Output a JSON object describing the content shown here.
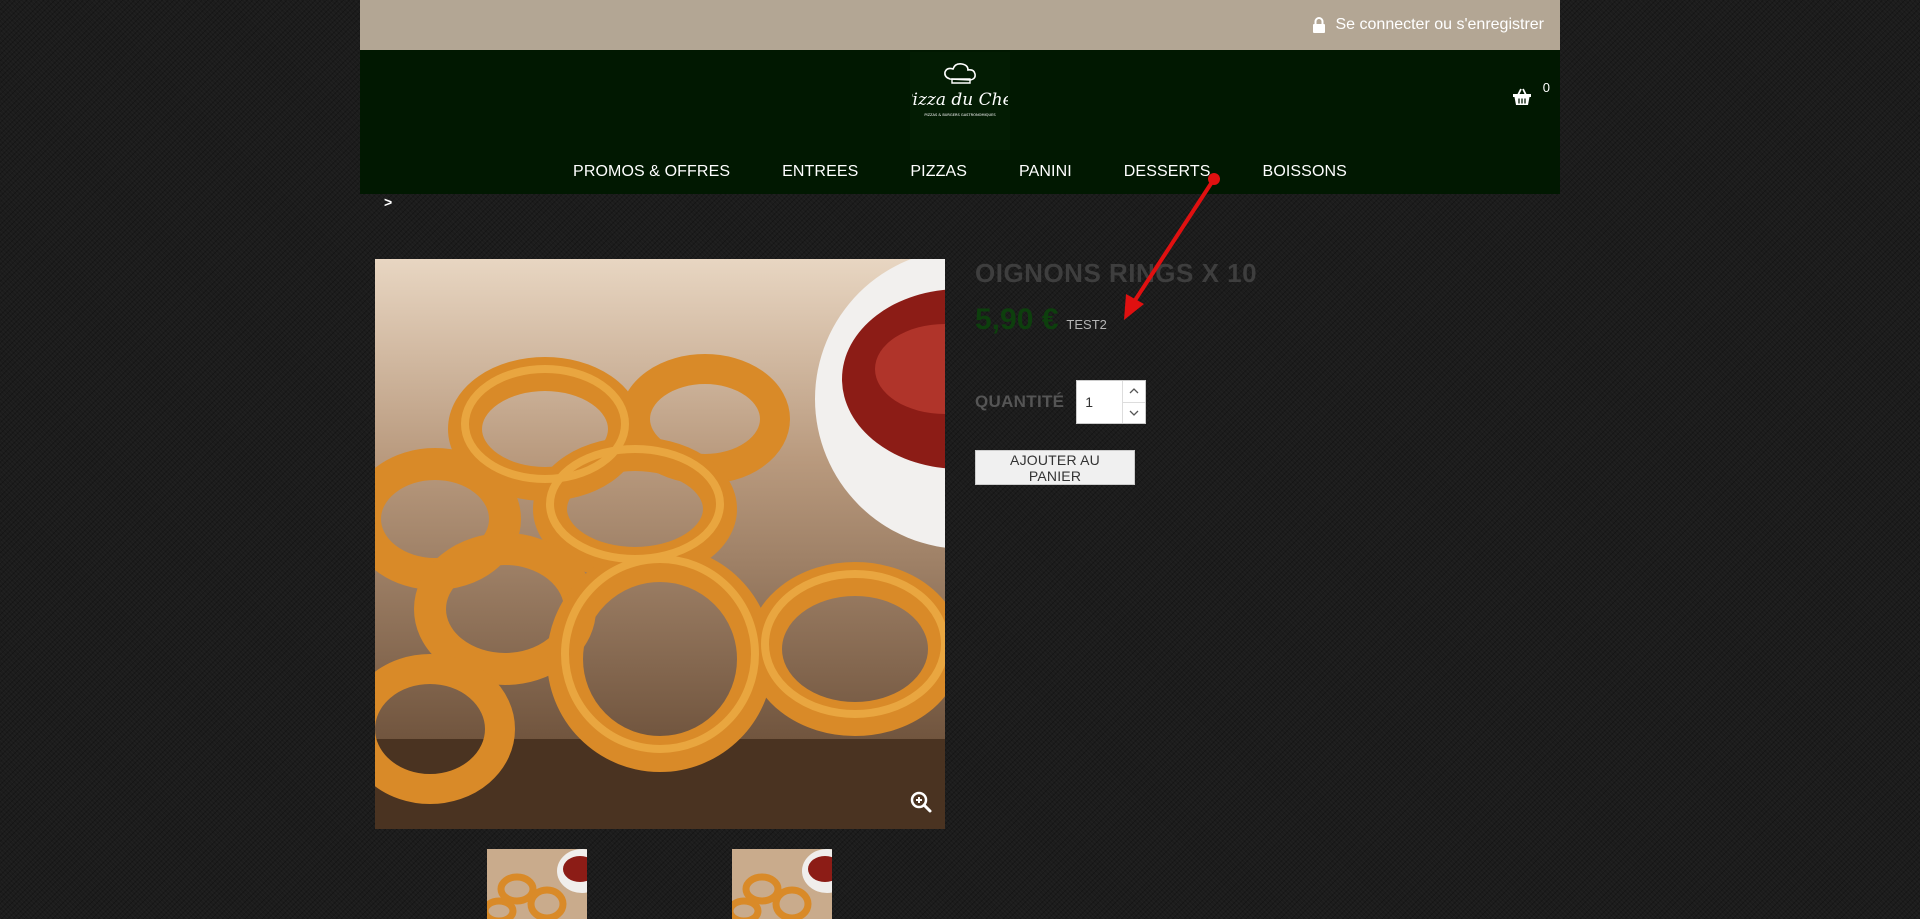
{
  "topbar": {
    "login_label": "Se connecter ou s'enregistrer"
  },
  "logo": {
    "text": "Pizza du Chef",
    "tagline": "PIZZAS & BURGERS GASTRONOMIQUES"
  },
  "cart": {
    "count": "0"
  },
  "nav": {
    "items": [
      {
        "label": "PROMOS & OFFRES"
      },
      {
        "label": "ENTREES"
      },
      {
        "label": "PIZZAS"
      },
      {
        "label": "PANINI"
      },
      {
        "label": "DESSERTS"
      },
      {
        "label": "BOISSONS"
      }
    ]
  },
  "breadcrumb": {
    "separator": ">"
  },
  "product": {
    "title": "OIGNONS RINGS X 10",
    "price": "5,90 €",
    "tax_label": "TEST2",
    "quantity_label": "QUANTITÉ",
    "quantity_value": "1",
    "add_to_cart_label": "AJOUTER AU PANIER"
  },
  "colors": {
    "topbar": "#b3a694",
    "header": "#011801",
    "price": "#0d3f0d",
    "annotation_arrow": "#e01010"
  },
  "icons": {
    "login": "lock-icon",
    "cart": "basket-icon",
    "zoom": "zoom-in-icon",
    "qty_up": "chevron-up-icon",
    "qty_down": "chevron-down-icon"
  }
}
